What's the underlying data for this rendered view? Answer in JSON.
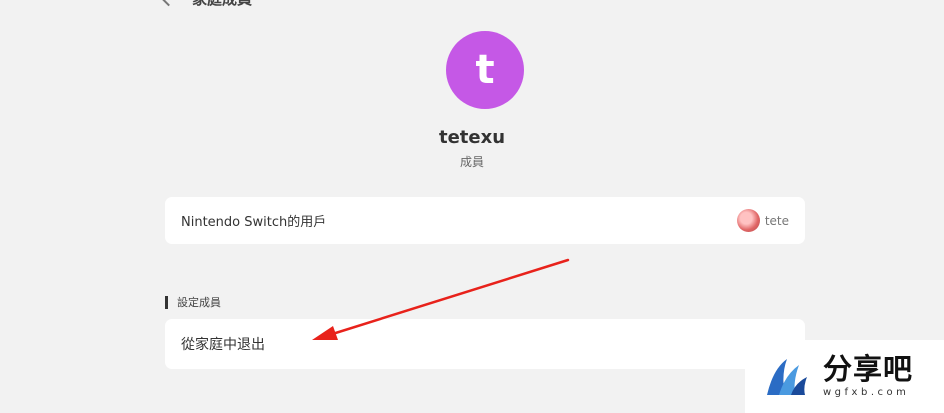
{
  "header": {
    "title": "家庭成員"
  },
  "user": {
    "avatar_letter": "t",
    "avatar_color": "#c558e6",
    "name": "tetexu",
    "role": "成員"
  },
  "switch_account": {
    "label": "Nintendo Switch的用戶",
    "account_name": "tete"
  },
  "settings_section": {
    "title": "設定成員"
  },
  "leave_family": {
    "label": "從家庭中退出"
  },
  "watermark": {
    "name": "分享吧",
    "url": "wgfxb.com"
  },
  "annotation": {
    "arrow_color": "#e8221b"
  }
}
